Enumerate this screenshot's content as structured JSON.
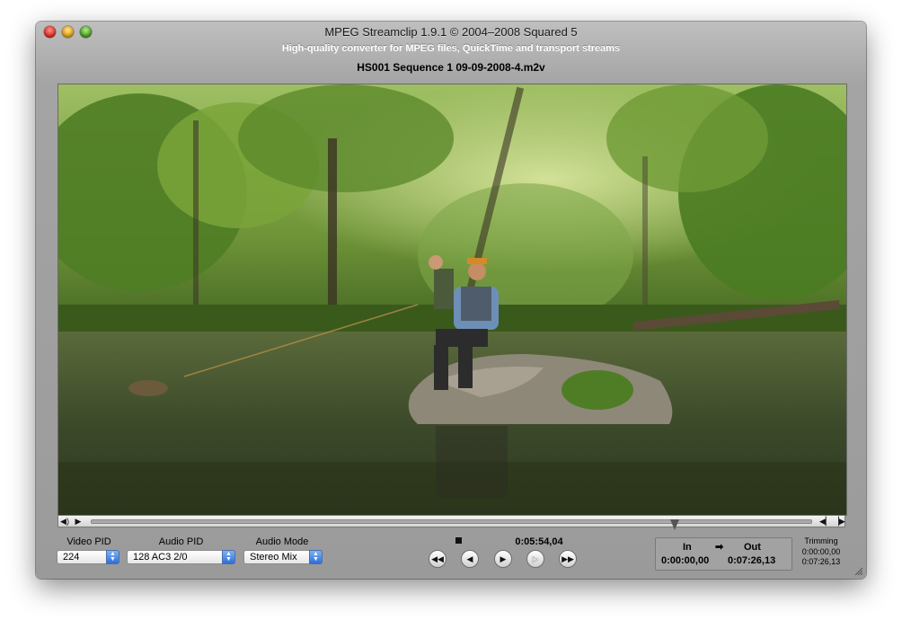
{
  "window": {
    "title": "MPEG Streamclip 1.9.1 © 2004–2008 Squared 5",
    "subtitle": "High-quality converter for MPEG files, QuickTime and transport streams",
    "filename": "HS001 Sequence 1 09-09-2008-4.m2v"
  },
  "controls": {
    "video_pid_label": "Video PID",
    "video_pid_value": "224",
    "audio_pid_label": "Audio PID",
    "audio_pid_value": "128 AC3 2/0",
    "audio_mode_label": "Audio Mode",
    "audio_mode_value": "Stereo Mix",
    "current_time": "0:05:54,04",
    "scrub_position_fraction": 0.81
  },
  "in_out": {
    "in_label": "In",
    "out_label": "Out",
    "arrow": "➡",
    "in_time": "0:00:00,00",
    "out_time": "0:07:26,13"
  },
  "trimming": {
    "label": "Trimming",
    "value1": "0:00:00,00",
    "value2": "0:07:26,13"
  },
  "icons": {
    "close": "close-button",
    "minimize": "minimize-button",
    "zoom": "zoom-button",
    "stop": "stop-icon",
    "rewind": "rewind-icon",
    "step_back": "step-back-icon",
    "play": "play-icon",
    "step_forward": "step-forward-icon",
    "fast_forward": "fast-forward-icon"
  }
}
